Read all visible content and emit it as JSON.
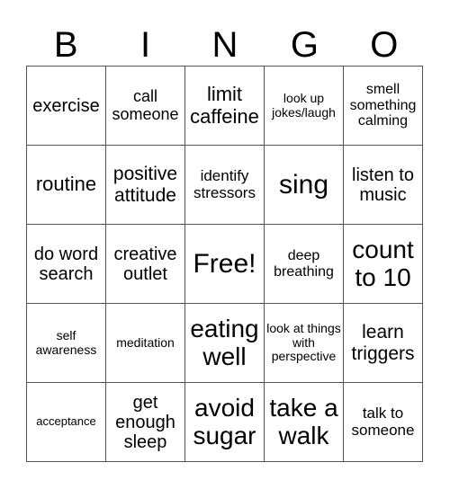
{
  "header": {
    "letters": [
      "B",
      "I",
      "N",
      "G",
      "O"
    ]
  },
  "board": {
    "rows": [
      [
        "exercise",
        "call someone",
        "limit caffeine",
        "look up jokes/laugh",
        "smell something calming"
      ],
      [
        "routine",
        "positive attitude",
        "identify stressors",
        "sing",
        "listen to music"
      ],
      [
        "do word search",
        "creative outlet",
        "Free!",
        "deep breathing",
        "count to 10"
      ],
      [
        "self awareness",
        "meditation",
        "eating well",
        "look at things with perspective",
        "learn triggers"
      ],
      [
        "acceptance",
        "get enough sleep",
        "avoid sugar",
        "take a walk",
        "talk to someone"
      ]
    ]
  }
}
